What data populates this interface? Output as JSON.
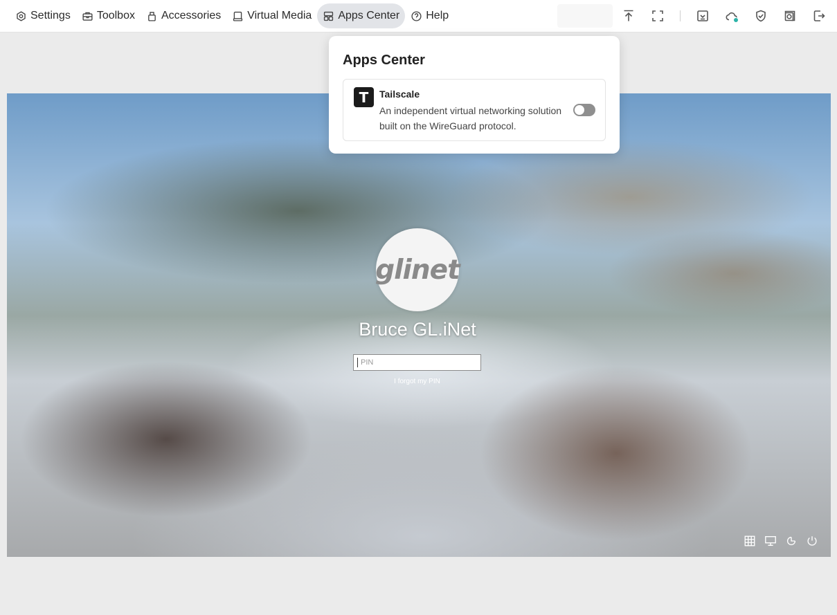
{
  "menu": {
    "items": [
      {
        "id": "settings",
        "label": "Settings",
        "icon": "settings-icon"
      },
      {
        "id": "toolbox",
        "label": "Toolbox",
        "icon": "toolbox-icon"
      },
      {
        "id": "accessories",
        "label": "Accessories",
        "icon": "accessories-icon"
      },
      {
        "id": "virtual-media",
        "label": "Virtual Media",
        "icon": "virtual-media-icon"
      },
      {
        "id": "apps-center",
        "label": "Apps Center",
        "icon": "apps-center-icon",
        "active": true
      },
      {
        "id": "help",
        "label": "Help",
        "icon": "help-icon"
      }
    ]
  },
  "toolbar": {
    "icons": [
      "upload-icon",
      "fullscreen-icon",
      "download-icon",
      "cloud-icon",
      "shield-check-icon",
      "history-icon",
      "logout-icon"
    ],
    "cloud_status_color": "#2bb3a8"
  },
  "apps_center": {
    "title": "Apps Center",
    "apps": [
      {
        "name": "Tailscale",
        "logo_letter": "T",
        "description": "An independent virtual networking solution built on the WireGuard protocol.",
        "enabled": false
      }
    ]
  },
  "remote_screen": {
    "avatar_text": "glinet",
    "user_name": "Bruce GL.iNet",
    "pin_placeholder": "PIN",
    "forgot_pin": "I forgot my PIN",
    "corner_icons": [
      "keyboard-icon",
      "network-icon",
      "accessibility-icon",
      "power-icon"
    ]
  },
  "colors": {
    "active_menu_bg": "#e2e4e8",
    "toggle_off": "#8f8f8f"
  }
}
